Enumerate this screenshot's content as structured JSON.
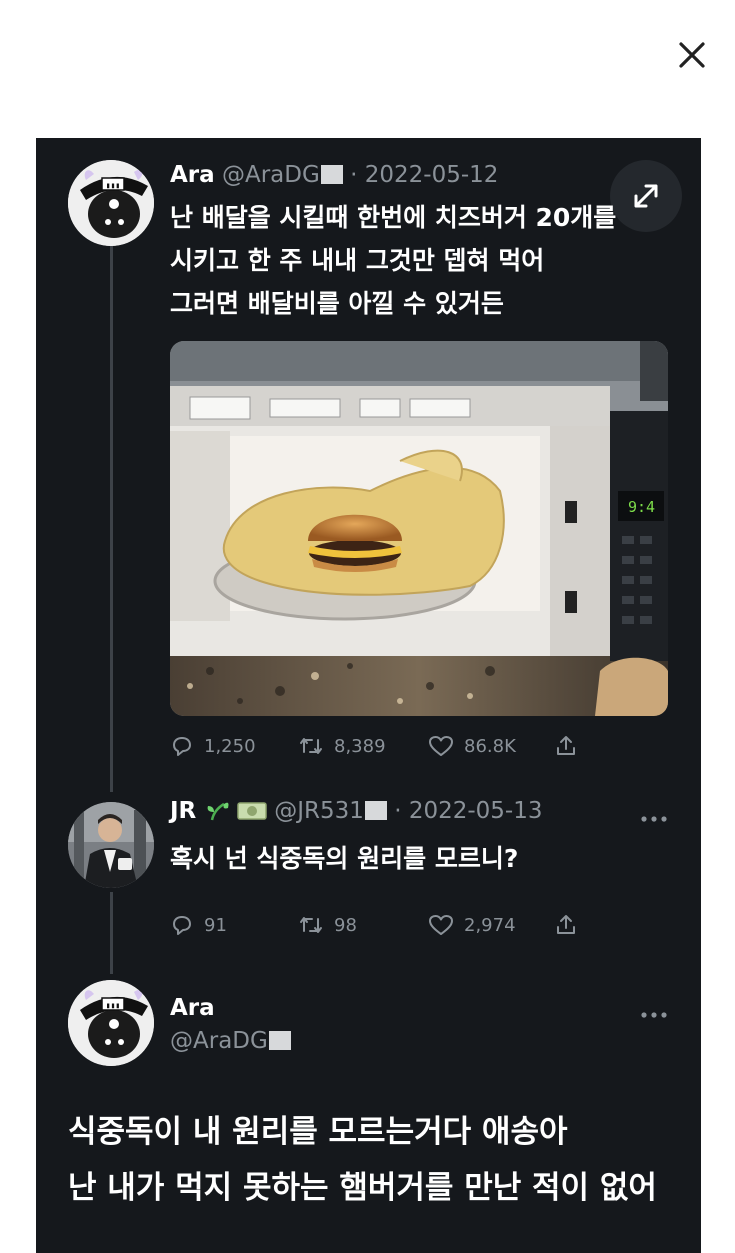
{
  "close_button": {
    "icon": "close-icon"
  },
  "tweets": [
    {
      "name": "Ara",
      "handle": "@AraDG",
      "date": "· 2022-05-12",
      "lines": [
        "난 배달을 시킬때 한번에 치즈버거 20개를",
        "시키고 한 주 내내 그것만 뎁혀 먹어",
        "그러면 배달비를 아낄 수 있거든"
      ],
      "media": {
        "clock": "9:4"
      },
      "stats": {
        "replies": "1,250",
        "retweets": "8,389",
        "likes": "86.8K"
      }
    },
    {
      "name": "JR",
      "badges": [
        "sprout-icon",
        "money-emoji-icon"
      ],
      "handle": "@JR531",
      "date": "· 2022-05-13",
      "lines": [
        "혹시 넌 식중독의 원리를 모르니?"
      ],
      "stats": {
        "replies": "91",
        "retweets": "98",
        "likes": "2,974"
      }
    },
    {
      "name": "Ara",
      "handle": "@AraDG",
      "lines": [
        "식중독이 내 원리를 모르는거다 애송아",
        "난 내가 먹지 못하는 햄버거를 만난 적이 없어"
      ]
    }
  ]
}
